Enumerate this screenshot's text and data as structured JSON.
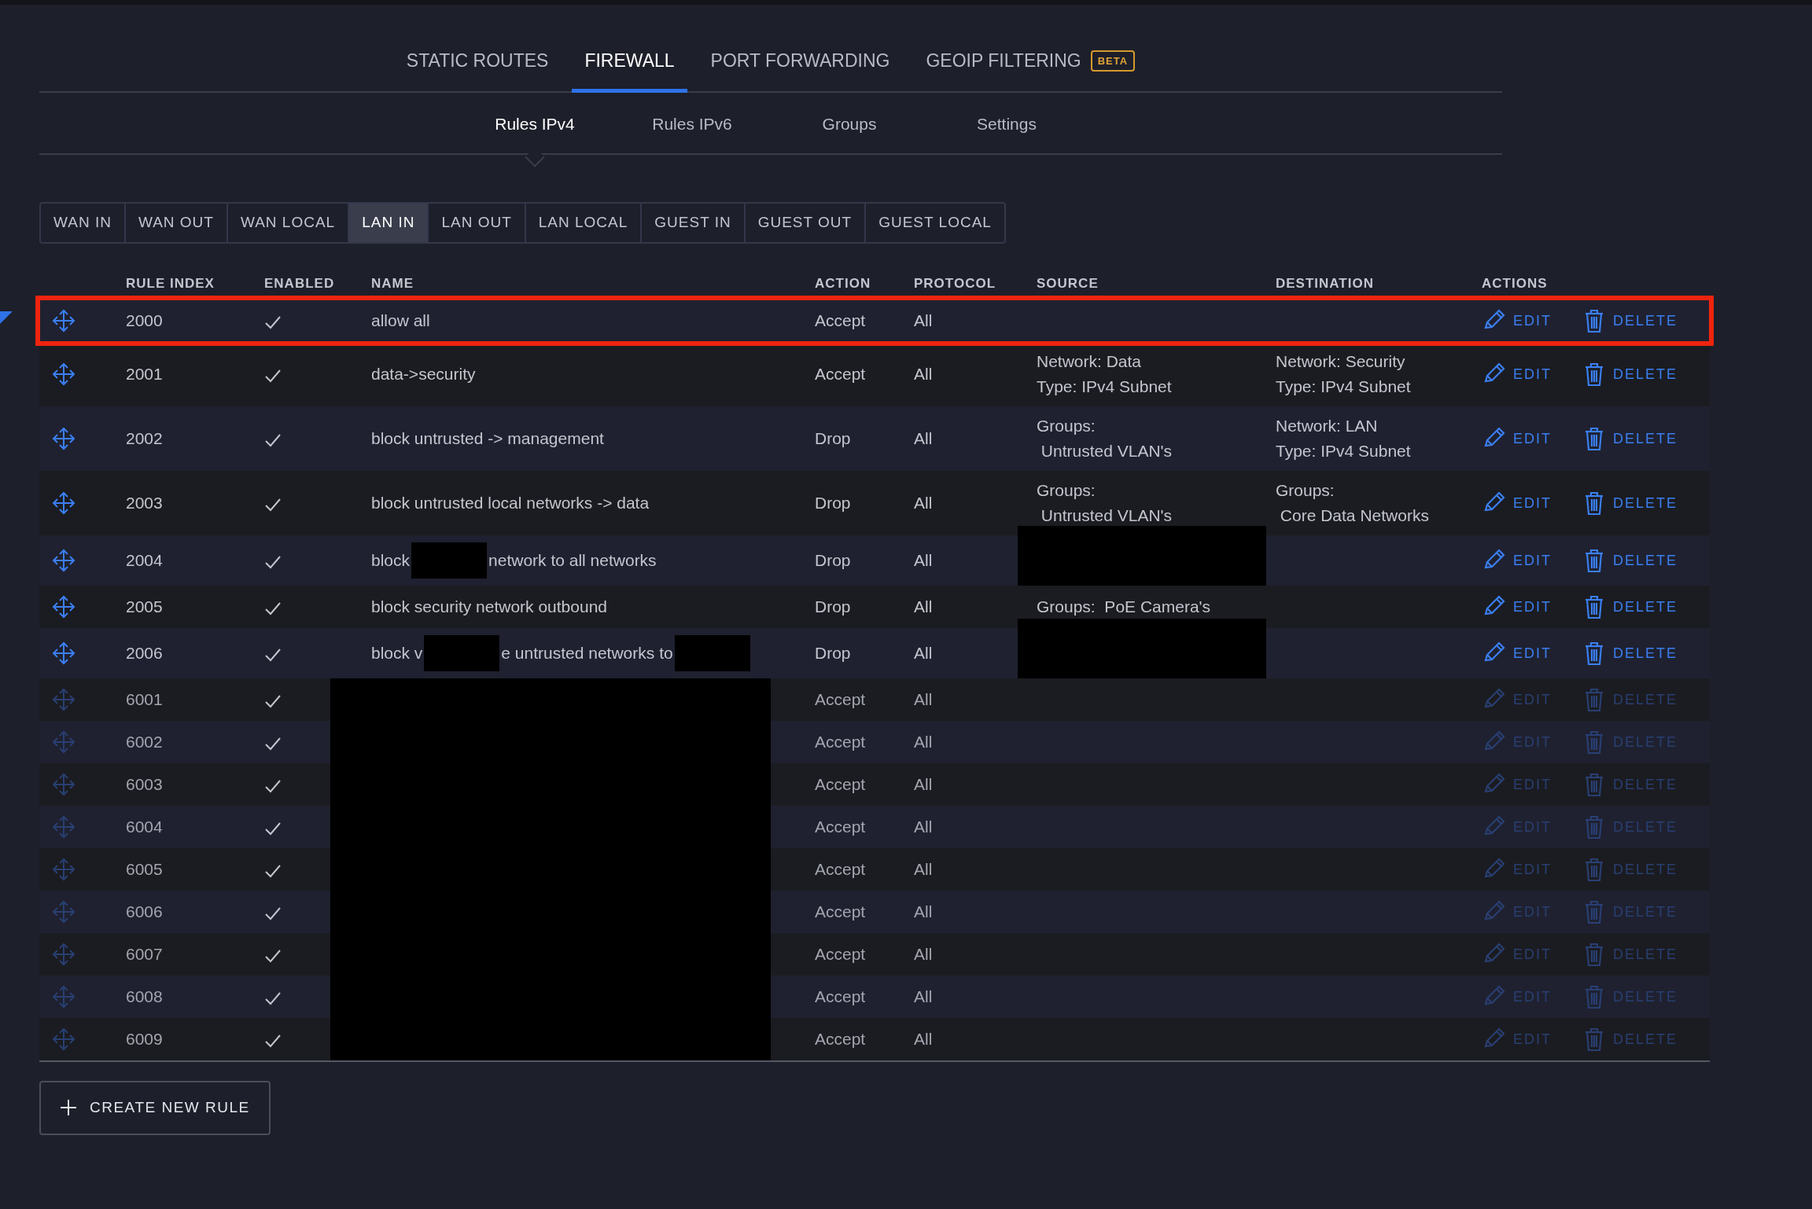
{
  "top_tabs": [
    {
      "label": "STATIC ROUTES",
      "selected": false
    },
    {
      "label": "FIREWALL",
      "selected": true
    },
    {
      "label": "PORT FORWARDING",
      "selected": false
    },
    {
      "label": "GEOIP FILTERING",
      "selected": false,
      "badge": "BETA"
    }
  ],
  "sub_tabs": [
    {
      "label": "Rules IPv4",
      "selected": true
    },
    {
      "label": "Rules IPv6",
      "selected": false
    },
    {
      "label": "Groups",
      "selected": false
    },
    {
      "label": "Settings",
      "selected": false
    }
  ],
  "chains": [
    {
      "label": "WAN IN",
      "selected": false
    },
    {
      "label": "WAN OUT",
      "selected": false
    },
    {
      "label": "WAN LOCAL",
      "selected": false
    },
    {
      "label": "LAN IN",
      "selected": true
    },
    {
      "label": "LAN OUT",
      "selected": false
    },
    {
      "label": "LAN LOCAL",
      "selected": false
    },
    {
      "label": "GUEST IN",
      "selected": false
    },
    {
      "label": "GUEST OUT",
      "selected": false
    },
    {
      "label": "GUEST LOCAL",
      "selected": false
    }
  ],
  "table": {
    "columns": [
      "RULE INDEX",
      "ENABLED",
      "NAME",
      "ACTION",
      "PROTOCOL",
      "SOURCE",
      "DESTINATION",
      "ACTIONS"
    ],
    "rows": [
      {
        "index": "2000",
        "enabled": true,
        "name": [
          {
            "kind": "text",
            "text": "allow all"
          }
        ],
        "action": "Accept",
        "protocol": "All",
        "edit": "EDIT",
        "delete": "DELETE",
        "locked": false,
        "highlighted": true
      },
      {
        "index": "2001",
        "enabled": true,
        "name": [
          {
            "kind": "text",
            "text": "data->security"
          }
        ],
        "action": "Accept",
        "protocol": "All",
        "source": {
          "kind": "lines",
          "lines": [
            "Network: Data",
            "Type: IPv4 Subnet"
          ]
        },
        "destination": {
          "kind": "lines",
          "lines": [
            "Network: Security",
            "Type: IPv4 Subnet"
          ]
        },
        "edit": "EDIT",
        "delete": "DELETE",
        "locked": false,
        "highlighted": false
      },
      {
        "index": "2002",
        "enabled": true,
        "name": [
          {
            "kind": "text",
            "text": "block untrusted -> management"
          }
        ],
        "action": "Drop",
        "protocol": "All",
        "source": {
          "kind": "lines",
          "lines": [
            "Groups:",
            " Untrusted VLAN's"
          ]
        },
        "destination": {
          "kind": "lines",
          "lines": [
            "Network: LAN",
            "Type: IPv4 Subnet"
          ]
        },
        "edit": "EDIT",
        "delete": "DELETE",
        "locked": false,
        "highlighted": false
      },
      {
        "index": "2003",
        "enabled": true,
        "name": [
          {
            "kind": "text",
            "text": "block untrusted local networks -> data"
          }
        ],
        "action": "Drop",
        "protocol": "All",
        "source": {
          "kind": "lines",
          "lines": [
            "Groups:",
            " Untrusted VLAN's"
          ]
        },
        "destination": {
          "kind": "lines",
          "lines": [
            "Groups:",
            " Core Data Networks"
          ]
        },
        "edit": "EDIT",
        "delete": "DELETE",
        "locked": false,
        "highlighted": false
      },
      {
        "index": "2004",
        "enabled": true,
        "name": [
          {
            "kind": "text",
            "text": "block"
          },
          {
            "kind": "redacted"
          },
          {
            "kind": "text",
            "text": "network to all networks"
          }
        ],
        "action": "Drop",
        "protocol": "All",
        "source": {
          "kind": "redacted"
        },
        "edit": "EDIT",
        "delete": "DELETE",
        "locked": false,
        "highlighted": false
      },
      {
        "index": "2005",
        "enabled": true,
        "name": [
          {
            "kind": "text",
            "text": "block security network outbound"
          }
        ],
        "action": "Drop",
        "protocol": "All",
        "source": {
          "kind": "lines",
          "lines": [
            "Groups:  PoE Camera's"
          ]
        },
        "edit": "EDIT",
        "delete": "DELETE",
        "locked": false,
        "highlighted": false
      },
      {
        "index": "2006",
        "enabled": true,
        "name": [
          {
            "kind": "text",
            "text": "block v"
          },
          {
            "kind": "redacted"
          },
          {
            "kind": "text",
            "text": "e untrusted networks to"
          },
          {
            "kind": "redacted"
          }
        ],
        "action": "Drop",
        "protocol": "All",
        "source": {
          "kind": "redacted"
        },
        "edit": "EDIT",
        "delete": "DELETE",
        "locked": false,
        "highlighted": false
      },
      {
        "index": "6001",
        "enabled": true,
        "name": [
          {
            "kind": "redacted"
          }
        ],
        "action": "Accept",
        "protocol": "All",
        "edit": "EDIT",
        "delete": "DELETE",
        "locked": true,
        "highlighted": false
      },
      {
        "index": "6002",
        "enabled": true,
        "name": [
          {
            "kind": "redacted"
          }
        ],
        "action": "Accept",
        "protocol": "All",
        "edit": "EDIT",
        "delete": "DELETE",
        "locked": true,
        "highlighted": false
      },
      {
        "index": "6003",
        "enabled": true,
        "name": [
          {
            "kind": "redacted"
          }
        ],
        "action": "Accept",
        "protocol": "All",
        "edit": "EDIT",
        "delete": "DELETE",
        "locked": true,
        "highlighted": false
      },
      {
        "index": "6004",
        "enabled": true,
        "name": [
          {
            "kind": "redacted"
          }
        ],
        "action": "Accept",
        "protocol": "All",
        "edit": "EDIT",
        "delete": "DELETE",
        "locked": true,
        "highlighted": false
      },
      {
        "index": "6005",
        "enabled": true,
        "name": [
          {
            "kind": "redacted"
          }
        ],
        "action": "Accept",
        "protocol": "All",
        "edit": "EDIT",
        "delete": "DELETE",
        "locked": true,
        "highlighted": false
      },
      {
        "index": "6006",
        "enabled": true,
        "name": [
          {
            "kind": "redacted"
          }
        ],
        "action": "Accept",
        "protocol": "All",
        "edit": "EDIT",
        "delete": "DELETE",
        "locked": true,
        "highlighted": false
      },
      {
        "index": "6007",
        "enabled": true,
        "name": [
          {
            "kind": "redacted"
          }
        ],
        "action": "Accept",
        "protocol": "All",
        "edit": "EDIT",
        "delete": "DELETE",
        "locked": true,
        "highlighted": false
      },
      {
        "index": "6008",
        "enabled": true,
        "name": [
          {
            "kind": "redacted"
          }
        ],
        "action": "Accept",
        "protocol": "All",
        "edit": "EDIT",
        "delete": "DELETE",
        "locked": true,
        "highlighted": false
      },
      {
        "index": "6009",
        "enabled": true,
        "name": [
          {
            "kind": "redacted"
          }
        ],
        "action": "Accept",
        "protocol": "All",
        "edit": "EDIT",
        "delete": "DELETE",
        "locked": true,
        "highlighted": false
      }
    ]
  },
  "create_button": "CREATE NEW RULE"
}
